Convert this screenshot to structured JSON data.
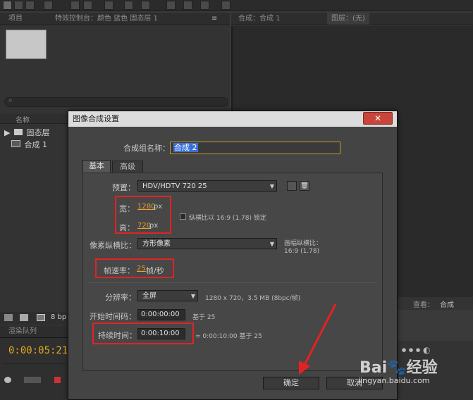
{
  "panels": {
    "project_tab": "项目",
    "effects_tab": "特效控制台：颜色 蓝色 固态层 1",
    "comp_tab": "合成：合成 1",
    "layer_tab": "图层：(无)",
    "name_header": "名称",
    "items": [
      "固态层",
      "合成 1"
    ],
    "bit_depth": "8 bp",
    "render_queue_tab": "渲染队列",
    "timecode": "0:00:05:21",
    "view_label": "查看：",
    "view_value": "合成"
  },
  "dialog": {
    "title": "图像合成设置",
    "close": "✕",
    "comp_name_label": "合成组名称：",
    "comp_name_value": "合成 2",
    "tabs": [
      "基本",
      "高级"
    ],
    "preset_label": "预置：",
    "preset_value": "HDV/HDTV 720 25",
    "width_label": "宽：",
    "width_value": "1280",
    "width_unit": "px",
    "height_label": "高：",
    "height_value": "720",
    "height_unit": "px",
    "lock_ratio_label": "纵横比以 16:9 (1.78) 锁定",
    "pixel_aspect_label": "像素纵横比：",
    "pixel_aspect_value": "方形像素",
    "frame_aspect_label": "画幅纵横比：",
    "frame_aspect_value": "16:9 (1.78)",
    "frame_rate_label": "帧速率：",
    "frame_rate_value": "25",
    "frame_rate_unit": "帧/秒",
    "resolution_label": "分辨率：",
    "resolution_value": "全屏",
    "resolution_info": "1280 x 720，3.5 MB (8bpc/帧)",
    "start_tc_label": "开始时间码：",
    "start_tc_value": "0:00:00:00",
    "start_tc_base": "基于 25",
    "duration_label": "持续时间：",
    "duration_value": "0:00:10:00",
    "duration_info": "= 0:00:10:00  基于 25",
    "ok": "确定",
    "cancel": "取消"
  },
  "watermark": {
    "brand": "Bai",
    "brand2": "经验",
    "url": "jingyan.baidu.com"
  }
}
